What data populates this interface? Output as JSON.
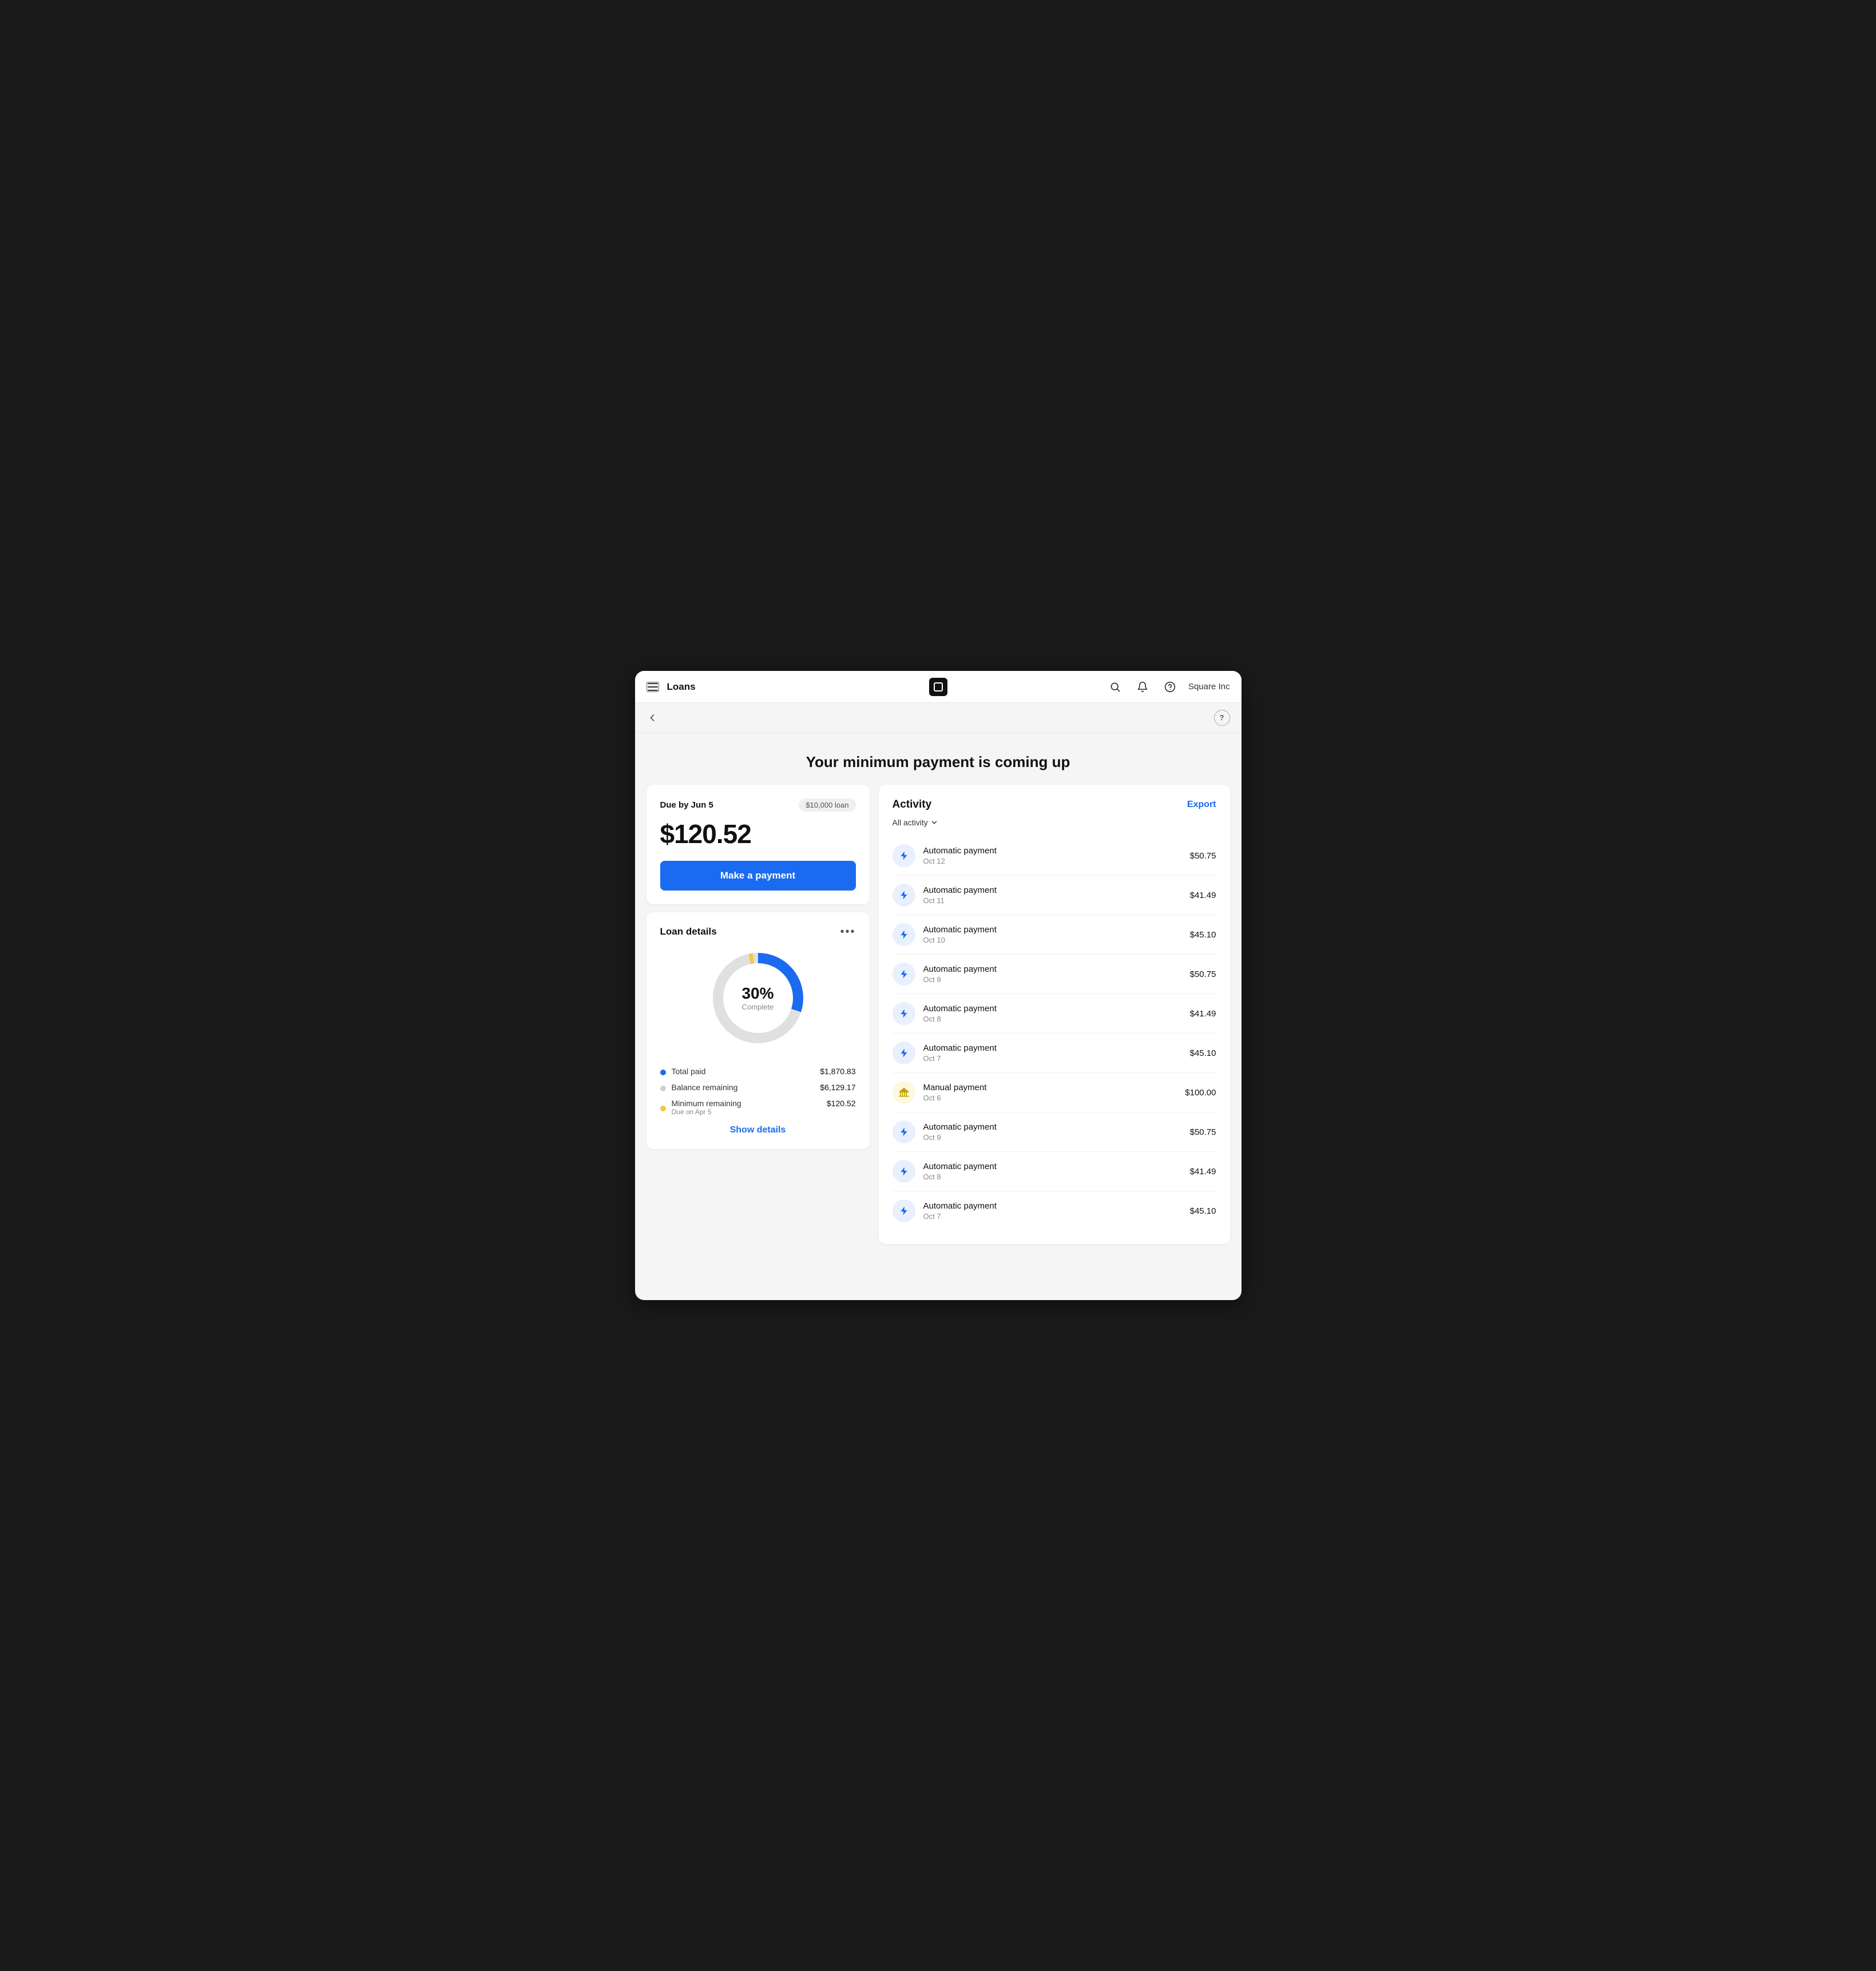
{
  "nav": {
    "menu_label": "Menu",
    "title": "Loans",
    "company": "Square Inc",
    "search_label": "Search",
    "bell_label": "Notifications",
    "help_label": "Help"
  },
  "sub_nav": {
    "back_label": "Back",
    "help_label": "Help"
  },
  "page": {
    "heading": "Your minimum payment is coming up"
  },
  "payment_card": {
    "due_label": "Due by Jun 5",
    "loan_badge": "$10,000 loan",
    "amount": "$120.52",
    "button_label": "Make a payment"
  },
  "loan_details": {
    "title": "Loan details",
    "percent": "30%",
    "complete_label": "Complete",
    "legend": [
      {
        "label": "Total paid",
        "color": "#1a6bf0",
        "value": "$1,870.83",
        "sub": ""
      },
      {
        "label": "Balance remaining",
        "color": "#d0d0d0",
        "value": "$6,129.17",
        "sub": ""
      },
      {
        "label": "Minimum remaining",
        "color": "#f5c842",
        "value": "$120.52",
        "sub": "Due on Apr 5"
      }
    ],
    "show_details_label": "Show details"
  },
  "activity": {
    "title": "Activity",
    "export_label": "Export",
    "filter_label": "All activity",
    "items": [
      {
        "name": "Automatic payment",
        "date": "Oct 12",
        "amount": "$50.75",
        "icon": "lightning",
        "icon_type": "blue"
      },
      {
        "name": "Automatic payment",
        "date": "Oct 11",
        "amount": "$41.49",
        "icon": "lightning",
        "icon_type": "blue"
      },
      {
        "name": "Automatic payment",
        "date": "Oct 10",
        "amount": "$45.10",
        "icon": "lightning",
        "icon_type": "blue"
      },
      {
        "name": "Automatic payment",
        "date": "Oct 9",
        "amount": "$50.75",
        "icon": "lightning",
        "icon_type": "blue"
      },
      {
        "name": "Automatic payment",
        "date": "Oct 8",
        "amount": "$41.49",
        "icon": "lightning",
        "icon_type": "blue"
      },
      {
        "name": "Automatic payment",
        "date": "Oct 7",
        "amount": "$45.10",
        "icon": "lightning",
        "icon_type": "blue"
      },
      {
        "name": "Manual payment",
        "date": "Oct 6",
        "amount": "$100.00",
        "icon": "bank",
        "icon_type": "yellow"
      },
      {
        "name": "Automatic payment",
        "date": "Oct 9",
        "amount": "$50.75",
        "icon": "lightning",
        "icon_type": "blue"
      },
      {
        "name": "Automatic payment",
        "date": "Oct 8",
        "amount": "$41.49",
        "icon": "lightning",
        "icon_type": "blue"
      },
      {
        "name": "Automatic payment",
        "date": "Oct 7",
        "amount": "$45.10",
        "icon": "lightning",
        "icon_type": "blue"
      }
    ]
  },
  "donut": {
    "total_angle": 360,
    "paid_pct": 0.3,
    "remaining_pct": 0.685,
    "minimum_pct": 0.015
  }
}
